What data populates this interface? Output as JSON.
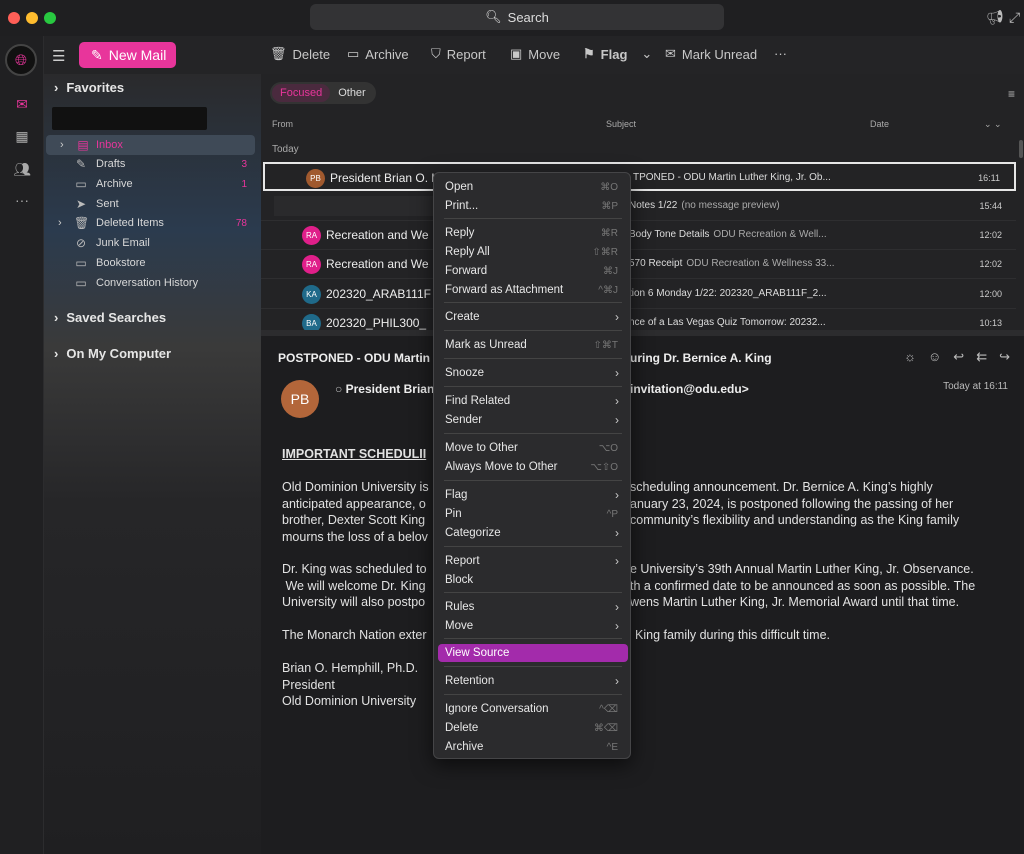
{
  "window": {
    "search_label": "Search"
  },
  "toolbar": {
    "new_mail": "New Mail",
    "delete": "Delete",
    "archive": "Archive",
    "report": "Report",
    "move": "Move",
    "flag": "Flag",
    "mark_unread": "Mark Unread",
    "more": "···"
  },
  "sidebar": {
    "favorites": "Favorites",
    "saved_searches": "Saved Searches",
    "on_my_computer": "On My Computer",
    "folders": [
      {
        "label": "Inbox",
        "count": "",
        "icon": "inbox-icon"
      },
      {
        "label": "Drafts",
        "count": "3",
        "icon": "drafts-icon"
      },
      {
        "label": "Archive",
        "count": "1",
        "icon": "archive-icon"
      },
      {
        "label": "Sent",
        "count": "",
        "icon": "sent-icon"
      },
      {
        "label": "Deleted Items",
        "count": "78",
        "icon": "trash-icon"
      },
      {
        "label": "Junk Email",
        "count": "",
        "icon": "junk-icon"
      },
      {
        "label": "Bookstore",
        "count": "",
        "icon": "folder-icon"
      },
      {
        "label": "Conversation History",
        "count": "",
        "icon": "folder-icon"
      }
    ]
  },
  "list": {
    "tab_focused": "Focused",
    "tab_other": "Other",
    "col_from": "From",
    "col_subject": "Subject",
    "col_date": "Date",
    "group_today": "Today",
    "rows": [
      {
        "initials": "PB",
        "avatar_color": "#a0592e",
        "from": "President Brian O. H",
        "subject": "TPONED - ODU Martin Luther King, Jr. Ob...",
        "preview": "",
        "time": "16:11"
      },
      {
        "initials": "",
        "avatar_color": "",
        "from": "",
        "subject": "Notes 1/22",
        "preview": "(no message preview)",
        "time": "15:44"
      },
      {
        "initials": "RA",
        "avatar_color": "#e01f8a",
        "from": "Recreation and We",
        "subject": "Body Tone Details",
        "preview": "ODU Recreation & Well...",
        "time": "12:02"
      },
      {
        "initials": "RA",
        "avatar_color": "#e01f8a",
        "from": "Recreation and We",
        "subject": "570 Receipt",
        "preview": "ODU Recreation & Wellness 33...",
        "time": "12:02"
      },
      {
        "initials": "KA",
        "avatar_color": "#1f6a8a",
        "from": "202320_ARAB111F",
        "subject": "tion 6 Monday 1/22: 202320_ARAB111F_2...",
        "preview": "",
        "time": "12:00"
      },
      {
        "initials": "BA",
        "avatar_color": "#1f6a8a",
        "from": "202320_PHIL300_",
        "subject": "nce of a Las Vegas Quiz Tomorrow: 20232...",
        "preview": "",
        "time": "10:13"
      }
    ]
  },
  "reading": {
    "subject_left": "POSTPONED - ODU Martin",
    "subject_right": "uring Dr. Bernice A. King",
    "avatar_initials": "PB",
    "sender_left": "President Brian",
    "sender_right": "invitation@odu.edu>",
    "date": "Today at 16:11",
    "heading": "IMPORTANT SCHEDULII",
    "p1_left": [
      "Old Dominion University is",
      "anticipated appearance, o",
      "brother, Dexter Scott King",
      "mourns the loss of a belov"
    ],
    "p1_right": [
      "scheduling announcement.  Dr. Bernice A. King’s highly",
      "anuary 23, 2024, is postponed following the passing of her",
      "community’s flexibility and understanding as the King family",
      ""
    ],
    "p2_left": [
      "Dr. King was scheduled to",
      " We will welcome Dr. King",
      "University will also postpo"
    ],
    "p2_right": [
      "e University’s 39th Annual Martin Luther King, Jr. Observance.",
      "th a confirmed date to be announced as soon as possible. The",
      "wens Martin Luther King, Jr. Memorial Award until that time."
    ],
    "p3_left": "The Monarch Nation exter",
    "p3_right": "King family during this difficult time.",
    "sig": [
      "Brian O. Hemphill, Ph.D.",
      "President",
      "Old Dominion University"
    ]
  },
  "context_menu": {
    "items": [
      {
        "label": "Open",
        "shortcut": "⌘O",
        "submenu": false
      },
      {
        "label": "Print...",
        "shortcut": "⌘P",
        "submenu": false
      },
      {
        "label": "Reply",
        "shortcut": "⌘R",
        "submenu": false
      },
      {
        "label": "Reply All",
        "shortcut": "⇧⌘R",
        "submenu": false
      },
      {
        "label": "Forward",
        "shortcut": "⌘J",
        "submenu": false
      },
      {
        "label": "Forward as Attachment",
        "shortcut": "^⌘J",
        "submenu": false
      },
      {
        "label": "Create",
        "shortcut": "",
        "submenu": true
      },
      {
        "label": "Mark as Unread",
        "shortcut": "⇧⌘T",
        "submenu": false
      },
      {
        "label": "Snooze",
        "shortcut": "",
        "submenu": true
      },
      {
        "label": "Find Related",
        "shortcut": "",
        "submenu": true
      },
      {
        "label": "Sender",
        "shortcut": "",
        "submenu": true
      },
      {
        "label": "Move to Other",
        "shortcut": "⌥O",
        "submenu": false
      },
      {
        "label": "Always Move to Other",
        "shortcut": "⌥⇧O",
        "submenu": false
      },
      {
        "label": "Flag",
        "shortcut": "",
        "submenu": true
      },
      {
        "label": "Pin",
        "shortcut": "^P",
        "submenu": false
      },
      {
        "label": "Categorize",
        "shortcut": "",
        "submenu": true
      },
      {
        "label": "Report",
        "shortcut": "",
        "submenu": true
      },
      {
        "label": "Block",
        "shortcut": "",
        "submenu": false
      },
      {
        "label": "Rules",
        "shortcut": "",
        "submenu": true
      },
      {
        "label": "Move",
        "shortcut": "",
        "submenu": true
      },
      {
        "label": "View Source",
        "shortcut": "",
        "submenu": false
      },
      {
        "label": "Retention",
        "shortcut": "",
        "submenu": true
      },
      {
        "label": "Ignore Conversation",
        "shortcut": "^⌫",
        "submenu": false
      },
      {
        "label": "Delete",
        "shortcut": "⌘⌫",
        "submenu": false
      },
      {
        "label": "Archive",
        "shortcut": "^E",
        "submenu": false
      }
    ]
  },
  "colors": {
    "accent": "#e8359b",
    "menu_highlight": "#a32bab"
  }
}
